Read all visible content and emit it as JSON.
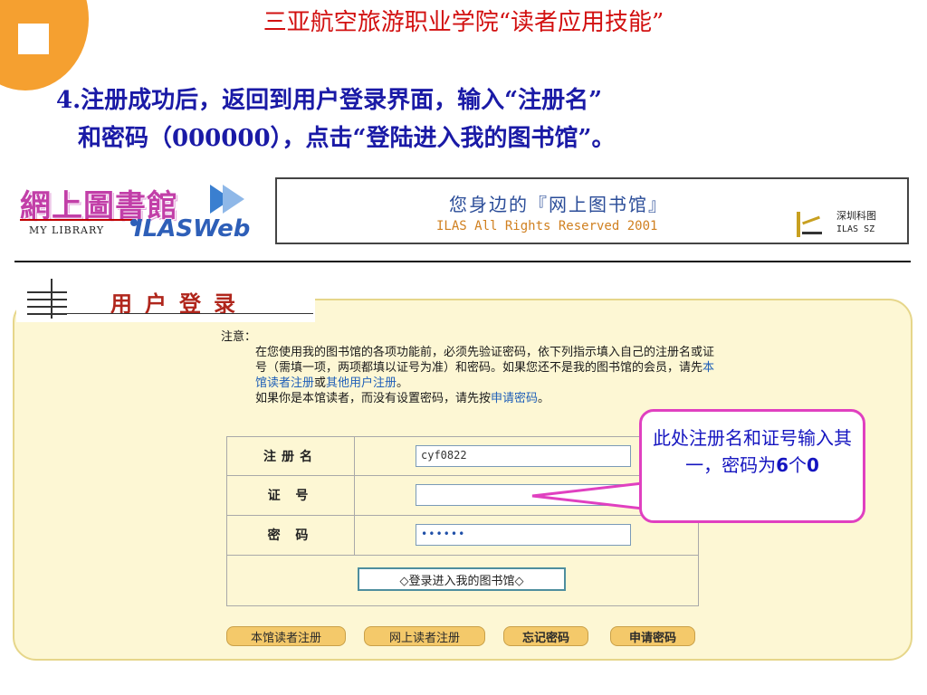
{
  "slide": {
    "title": "三亚航空旅游职业学院“读者应用技能”",
    "instruction_line1": "4.注册成功后，返回到用户登录界面，输入“注册名”",
    "instruction_line2": "和密码（000000），点击“登陆进入我的图书馆”。"
  },
  "logo": {
    "cn_text": "網上圖書館",
    "en_text": "MY LIBRARY",
    "brand": "ILASWeb"
  },
  "banner": {
    "title": "您身边的『网上图书馆』",
    "subtitle": "ILAS All Rights Reserved 2001",
    "company_line1": "深圳科图",
    "company_line2": "ILAS  SZ"
  },
  "login": {
    "title": "用户登录",
    "notice": {
      "heading": "注意：",
      "para1": "在您使用我的图书馆的各项功能前，必须先验证密码，依下列指示填入自己的注册名或证号（需填一项，两项都填以证号为准）和密码。如果您还不是我的图书馆的会员，请先",
      "link_local_register": "本馆读者注册",
      "or": "或",
      "link_other_user": "其他用户注册",
      "period": "。",
      "para2": "如果你是本馆读者，而没有设置密码，请先按",
      "link_apply_password": "申请密码",
      "para2_end": "。"
    },
    "fields": {
      "username_label": "注册名",
      "username_value": "cyf0822",
      "card_label": "证 号",
      "card_value": "",
      "password_label": "密 码",
      "password_value": "••••••"
    },
    "submit_label": "◇登录进入我的图书馆◇",
    "bottom_buttons": [
      "本馆读者注册",
      "网上读者注册",
      "忘记密码",
      "申请密码"
    ]
  },
  "callout": {
    "text_part1": "此处注册名和证号输入其一，密码为",
    "num1": "6",
    "mid": "个",
    "num2": "0"
  },
  "colors": {
    "title_red": "#d21010",
    "instruction_blue": "#1a1aa6",
    "panel_bg": "#fdf7d4",
    "button_bg": "#f4c96a",
    "callout_border": "#e040c0",
    "orb_orange": "#f5a030"
  }
}
